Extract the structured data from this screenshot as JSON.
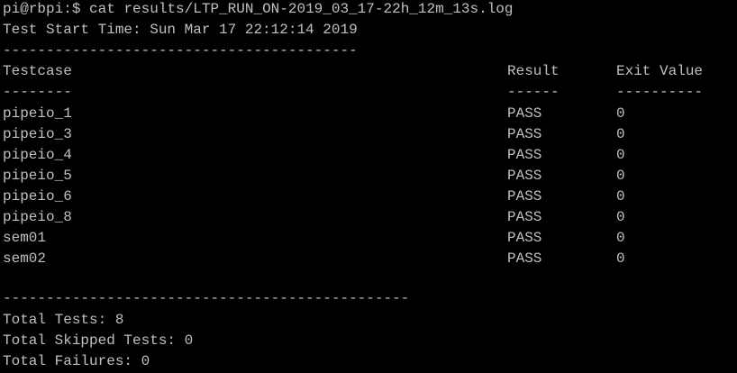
{
  "terminal": {
    "prompt": "pi@rbpi:$",
    "command": "cat results/LTP_RUN_ON-2019_03_17-22h_12m_13s.log",
    "start_time": "Test Start Time: Sun Mar 17 22:12:14 2019",
    "separator_short": "-----------------------------------------",
    "header": {
      "testcase": "Testcase",
      "result": "Result",
      "exit_value": "Exit Value"
    },
    "header_underline": {
      "testcase": "--------",
      "result": "------",
      "exit_value": "----------"
    },
    "rows": [
      {
        "name": "pipeio_1",
        "result": "PASS",
        "exit": "0"
      },
      {
        "name": "pipeio_3",
        "result": "PASS",
        "exit": "0"
      },
      {
        "name": "pipeio_4",
        "result": "PASS",
        "exit": "0"
      },
      {
        "name": "pipeio_5",
        "result": "PASS",
        "exit": "0"
      },
      {
        "name": "pipeio_6",
        "result": "PASS",
        "exit": "0"
      },
      {
        "name": "pipeio_8",
        "result": "PASS",
        "exit": "0"
      },
      {
        "name": "sem01",
        "result": "PASS",
        "exit": "0"
      },
      {
        "name": "sem02",
        "result": "PASS",
        "exit": "0"
      }
    ],
    "separator_long": "-----------------------------------------------",
    "summary": {
      "total_tests": "Total Tests: 8",
      "total_skipped": "Total Skipped Tests: 0",
      "total_failures": "Total Failures: 0"
    },
    "colors": {
      "background": "#000000",
      "text": "#c0c0c0"
    }
  }
}
